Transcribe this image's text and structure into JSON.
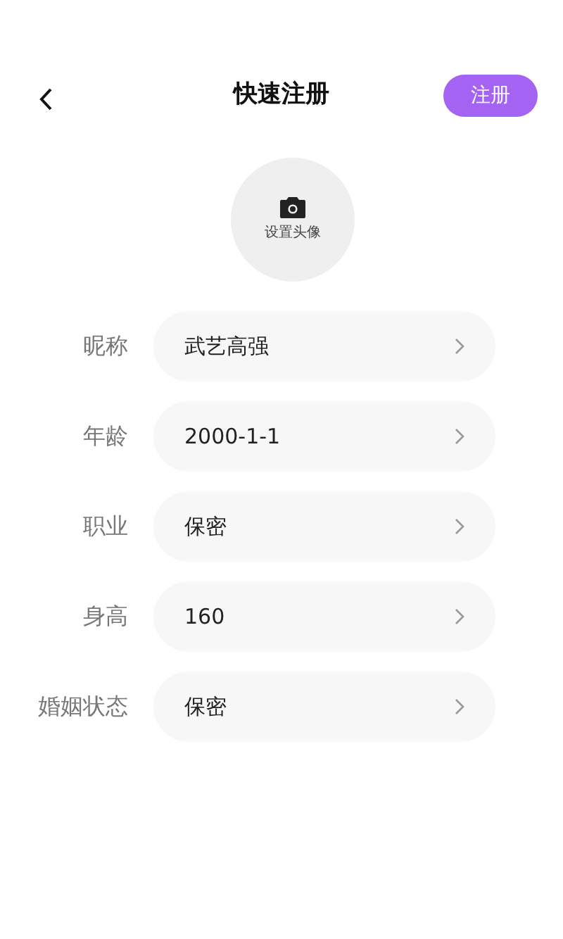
{
  "header": {
    "title": "快速注册",
    "action": "注册"
  },
  "avatar": {
    "label": "设置头像"
  },
  "fields": [
    {
      "label": "昵称",
      "value": "武艺高强"
    },
    {
      "label": "年龄",
      "value": "2000-1-1"
    },
    {
      "label": "职业",
      "value": "保密"
    },
    {
      "label": "身高",
      "value": "160"
    },
    {
      "label": "婚姻状态",
      "value": "保密"
    }
  ]
}
